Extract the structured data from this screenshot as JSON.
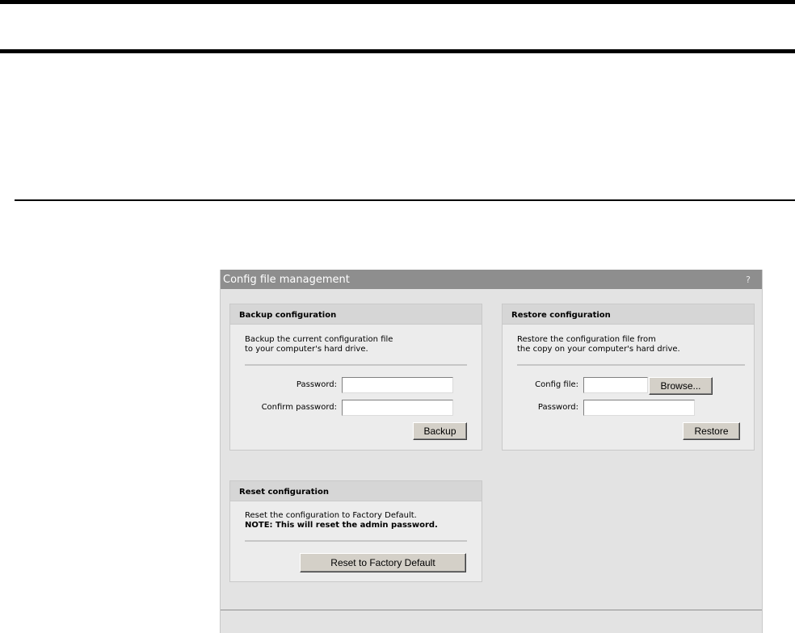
{
  "panel": {
    "title": "Config file management",
    "help_label": "?"
  },
  "backup": {
    "title": "Backup configuration",
    "desc_line1": "Backup the current configuration file",
    "desc_line2": "to your computer's hard drive.",
    "password_label": "Password:",
    "password_value": "",
    "confirm_label": "Confirm password:",
    "confirm_value": "",
    "button_label": "Backup"
  },
  "restore": {
    "title": "Restore configuration",
    "desc_line1": "Restore the configuration file from",
    "desc_line2": "the copy on your computer's hard drive.",
    "config_file_label": "Config file:",
    "config_file_value": "",
    "browse_label": "Browse...",
    "password_label": "Password:",
    "password_value": "",
    "button_label": "Restore"
  },
  "reset": {
    "title": "Reset configuration",
    "desc_line1": "Reset the configuration to Factory Default.",
    "desc_line2": "NOTE: This will reset the admin password.",
    "button_label": "Reset to Factory Default"
  }
}
